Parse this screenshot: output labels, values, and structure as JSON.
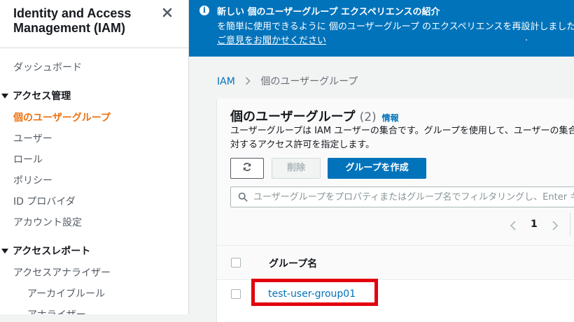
{
  "sidebar": {
    "title": "Identity and Access Management (IAM)",
    "close_icon": "close-icon",
    "items": [
      {
        "label": "ダッシュボード",
        "type": "item"
      },
      {
        "label": "アクセス管理",
        "type": "section"
      },
      {
        "label": "個のユーザーグループ",
        "type": "item",
        "active": true
      },
      {
        "label": "ユーザー",
        "type": "item"
      },
      {
        "label": "ロール",
        "type": "item"
      },
      {
        "label": "ポリシー",
        "type": "item"
      },
      {
        "label": "ID プロバイダ",
        "type": "item"
      },
      {
        "label": "アカウント設定",
        "type": "item"
      },
      {
        "label": "アクセスレポート",
        "type": "section"
      },
      {
        "label": "アクセスアナライザー",
        "type": "item"
      },
      {
        "label": "アーカイブルール",
        "type": "subitem"
      },
      {
        "label": "アナライザー",
        "type": "subitem"
      }
    ]
  },
  "banner": {
    "icon": "info-icon",
    "title": "新しい 個のユーザーグループ エクスペリエンスの紹介",
    "text": "を簡単に使用できるように 個のユーザーグループ のエクスペリエンスを再設計しました",
    "link": "ご意見をお聞かせください",
    "link_suffix": "."
  },
  "breadcrumb": {
    "root": "IAM",
    "current": "個のユーザーグループ"
  },
  "panel": {
    "title": "個のユーザーグループ",
    "count": "(2)",
    "info": "情報",
    "description": "ユーザーグループは IAM ユーザーの集合です。グループを使用して、ユーザーの集合に対するアクセス許可を指定します。",
    "buttons": {
      "refresh_icon": "refresh-icon",
      "delete": "削除",
      "create": "グループを作成"
    },
    "search": {
      "placeholder": "ユーザーグループをプロパティまたはグループ名でフィルタリングし、Enter キーを押します"
    },
    "pagination": {
      "page": "1"
    },
    "table": {
      "columns": [
        "グループ名"
      ],
      "rows": [
        {
          "name": "test-user-group01"
        }
      ]
    }
  },
  "colors": {
    "accent": "#ec7211",
    "banner": "#0073bb",
    "link": "#0073bb",
    "highlight": "#e2000f"
  }
}
